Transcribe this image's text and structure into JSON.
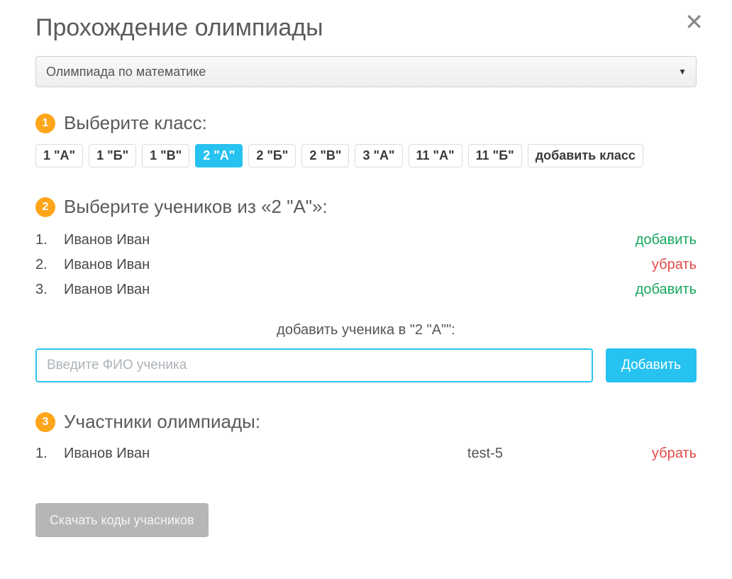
{
  "modal": {
    "title": "Прохождение олимпиады",
    "close_glyph": "✕"
  },
  "olympiad_select": {
    "value": "Олимпиада по математике"
  },
  "step1": {
    "num": "1",
    "title": "Выберите класс:",
    "classes": [
      {
        "label": "1 \"А\"",
        "active": false
      },
      {
        "label": "1 \"Б\"",
        "active": false
      },
      {
        "label": "1 \"В\"",
        "active": false
      },
      {
        "label": "2 \"А\"",
        "active": true
      },
      {
        "label": "2 \"Б\"",
        "active": false
      },
      {
        "label": "2 \"В\"",
        "active": false
      },
      {
        "label": "3 \"А\"",
        "active": false
      },
      {
        "label": "11 \"А\"",
        "active": false
      },
      {
        "label": "11 \"Б\"",
        "active": false
      }
    ],
    "add_class_label": "добавить класс"
  },
  "step2": {
    "num": "2",
    "title": "Выберите учеников из «2 \"А\"»:",
    "students": [
      {
        "n": "1.",
        "name": "Иванов Иван",
        "action": "add",
        "action_label": "добавить"
      },
      {
        "n": "2.",
        "name": "Иванов Иван",
        "action": "remove",
        "action_label": "убрать"
      },
      {
        "n": "3.",
        "name": "Иванов Иван",
        "action": "add",
        "action_label": "добавить"
      }
    ],
    "add_student_label": "добавить ученика в \"2 \"А\"\":",
    "fio_placeholder": "Введите ФИО ученика",
    "add_button": "Добавить"
  },
  "step3": {
    "num": "3",
    "title": "Участники олимпиады:",
    "participants": [
      {
        "n": "1.",
        "name": "Иванов Иван",
        "code": "test-5",
        "action_label": "убрать"
      }
    ]
  },
  "download_button": "Скачать коды учасников"
}
